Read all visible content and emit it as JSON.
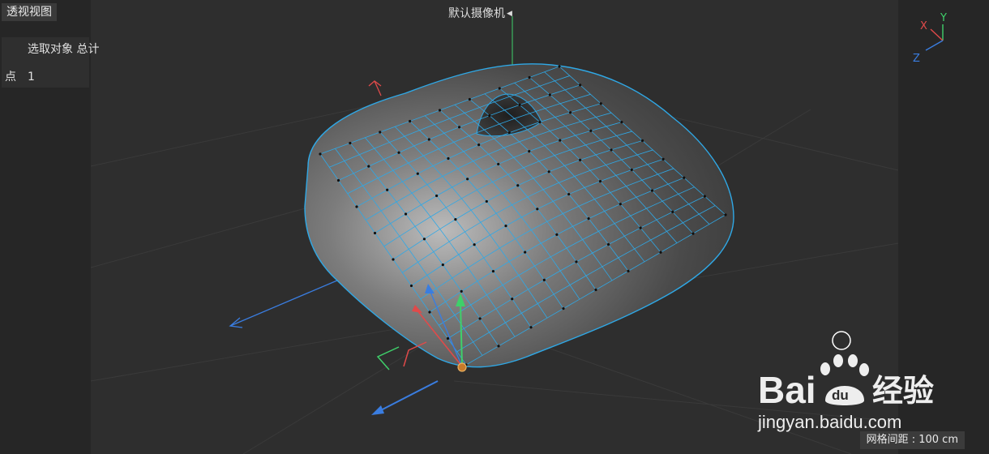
{
  "viewport": {
    "title": "透视视图",
    "camera": "默认摄像机",
    "camera_icon": "dropdown-triangle-icon"
  },
  "hud": {
    "header": "选取对象 总计",
    "rows": [
      {
        "label": "点",
        "value": "1"
      }
    ]
  },
  "axes": {
    "x": "X",
    "y": "Y",
    "z": "Z"
  },
  "colors": {
    "x_axis": "#e04a4a",
    "y_axis": "#3fd06a",
    "z_axis": "#3a7de0",
    "mesh_wire": "#2fa8e6",
    "background": "#2e2e2e"
  },
  "grid_spacing": "网格间距 : 100 cm",
  "watermark": {
    "brand_latin": "Bai",
    "brand_du": "du",
    "brand_cn": "经验",
    "url": "jingyan.baidu.com"
  }
}
